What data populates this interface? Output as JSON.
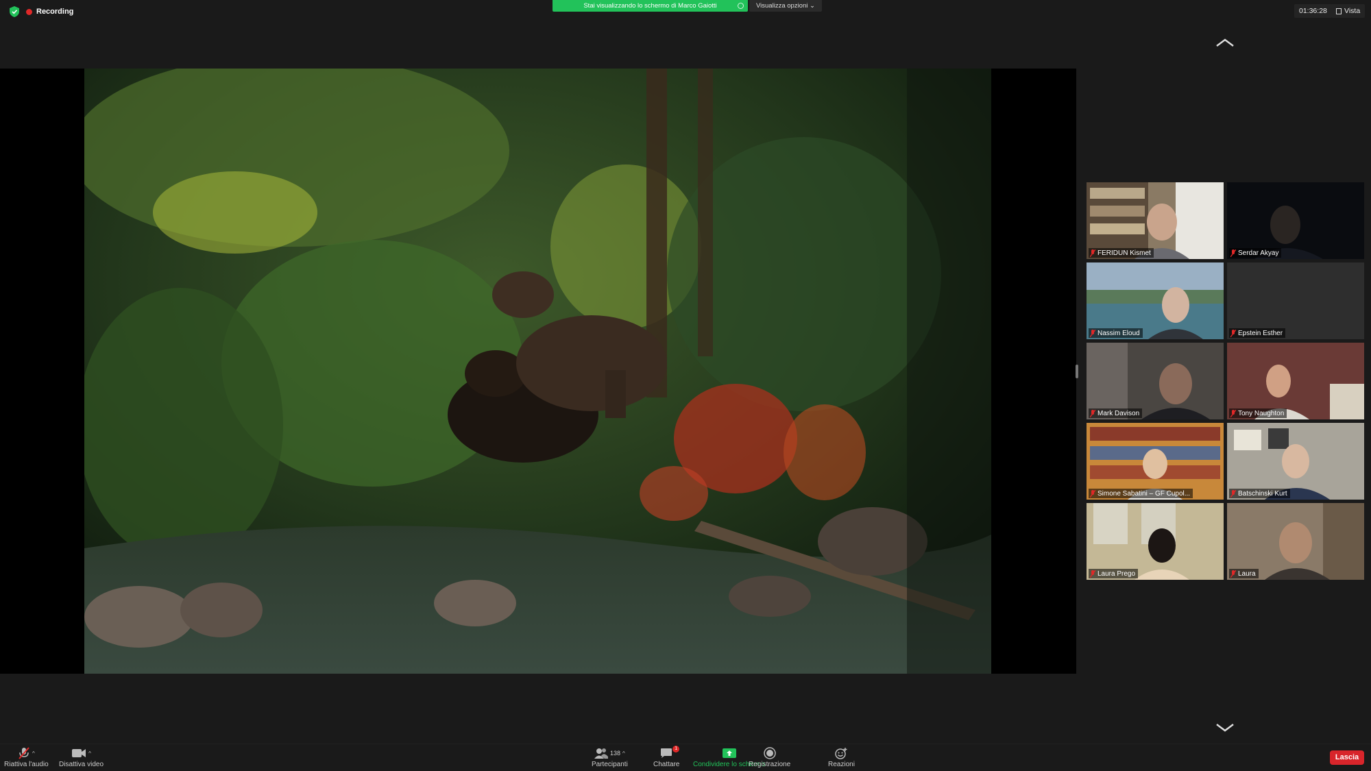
{
  "topbar": {
    "recording_label": "Recording",
    "share_banner": "Stai visualizzando lo schermo di Marco Gaiotti",
    "view_options": "Visualizza opzioni ⌄",
    "timer": "01:36:28",
    "view_label": "Vista"
  },
  "participants": [
    {
      "name": "FERIDUN Kismet"
    },
    {
      "name": "Serdar Akyay"
    },
    {
      "name": "Nassim Eloud"
    },
    {
      "name": "Epstein Esther"
    },
    {
      "name": "Mark Davison"
    },
    {
      "name": "Tony Naughton"
    },
    {
      "name": "Simone Sabatini – GF Cupol..."
    },
    {
      "name": "Batschinski Kurt"
    },
    {
      "name": "Laura Prego"
    },
    {
      "name": "Laura"
    }
  ],
  "toolbar": {
    "unmute": "Riattiva l'audio",
    "stop_video": "Disattiva video",
    "participants": "Partecipanti",
    "participants_count": "138",
    "chat": "Chattare",
    "chat_badge": "1",
    "share_screen": "Condividere lo schermo",
    "record": "Registrazione",
    "reactions": "Reazioni",
    "leave": "Lascia"
  },
  "colors": {
    "share_green": "#22c25a",
    "leave_red": "#d8252b",
    "mic_off_red": "#e02828"
  }
}
